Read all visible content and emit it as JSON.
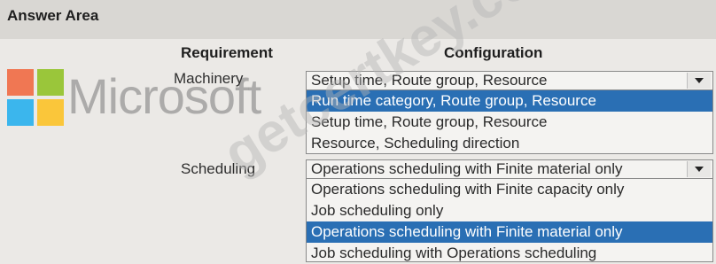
{
  "header": {
    "title": "Answer Area"
  },
  "columns": {
    "requirement": "Requirement",
    "configuration": "Configuration"
  },
  "rows": [
    {
      "label": "Machinery",
      "selected_value": "Setup time, Route group, Resource",
      "options": [
        "Run time category, Route group, Resource",
        "Setup time, Route group, Resource",
        "Resource, Scheduling direction"
      ],
      "highlighted_option_index": 0
    },
    {
      "label": "Scheduling",
      "selected_value": "Operations scheduling with Finite material only",
      "options": [
        "Operations scheduling with Finite capacity only",
        "Job scheduling only",
        "Operations scheduling with Finite material only",
        "Job scheduling with Operations scheduling"
      ],
      "highlighted_option_index": 2
    }
  ],
  "watermarks": {
    "brand": "Microsoft",
    "site": "getcertkey.com"
  },
  "colors": {
    "highlight": "#2a6fb4",
    "ms_red": "#f25022",
    "ms_green": "#7fba00",
    "ms_blue": "#00a4ef",
    "ms_yellow": "#ffb900"
  },
  "icons": {
    "dropdown": "chevron-down-icon",
    "logo": "microsoft-logo-icon"
  }
}
